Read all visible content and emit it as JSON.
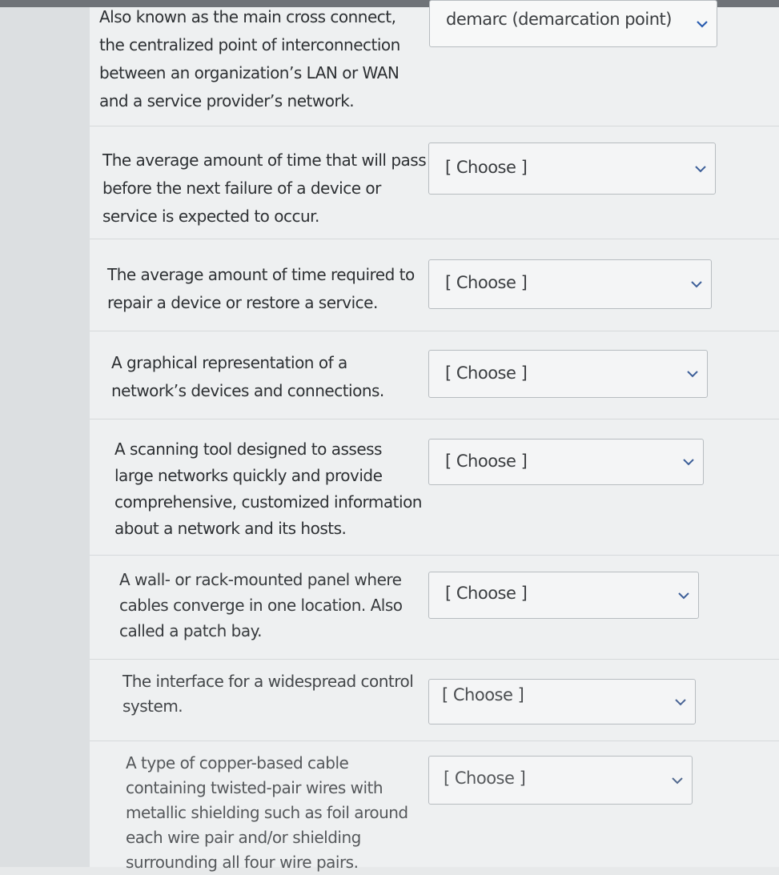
{
  "questions": [
    {
      "prompt": "Also known as the main cross connect, the centralized point of interconnection between an organization’s LAN or WAN and a service provider’s network.",
      "answer": "demarc (demarcation point)"
    },
    {
      "prompt": "The average amount of time that will pass before the next failure of a device or service is expected to occur.",
      "answer": "[ Choose ]"
    },
    {
      "prompt": "The average amount of time required to repair a device or restore a service.",
      "answer": "[ Choose ]"
    },
    {
      "prompt": "A graphical representation of a network’s devices and connections.",
      "answer": "[ Choose ]"
    },
    {
      "prompt": "A scanning tool designed to assess large networks quickly and provide comprehensive, customized information about a network and its hosts.",
      "answer": "[ Choose ]"
    },
    {
      "prompt": "A wall- or rack-mounted panel where cables converge in one location. Also called a patch bay.",
      "answer": "[ Choose ]"
    },
    {
      "prompt": "The interface for a widespread control system.",
      "answer": "[ Choose ]"
    },
    {
      "prompt": "A type of copper-based cable containing twisted-pair wires with metallic shielding such as foil around each wire pair and/or shielding surrounding all four wire pairs.",
      "answer": "[ Choose ]"
    }
  ],
  "icons": {
    "dropdown": "chevron-down-icon"
  }
}
